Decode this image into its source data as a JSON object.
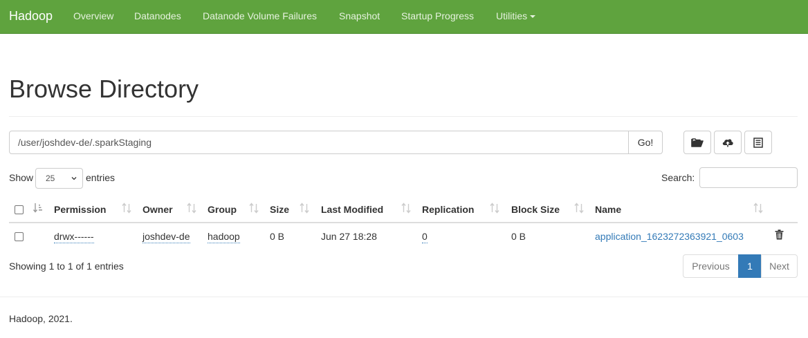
{
  "navbar": {
    "brand": "Hadoop",
    "items": [
      "Overview",
      "Datanodes",
      "Datanode Volume Failures",
      "Snapshot",
      "Startup Progress",
      "Utilities"
    ]
  },
  "page": {
    "title": "Browse Directory"
  },
  "path_bar": {
    "path": "/user/joshdev-de/.sparkStaging",
    "go_label": "Go!"
  },
  "toolbar_icons": [
    "folder-open-icon",
    "cloud-upload-icon",
    "list-icon"
  ],
  "table_controls": {
    "show_label": "Show",
    "page_length": "25",
    "entries_label": "entries",
    "search_label": "Search:",
    "search_value": ""
  },
  "table": {
    "columns": [
      "Permission",
      "Owner",
      "Group",
      "Size",
      "Last Modified",
      "Replication",
      "Block Size",
      "Name"
    ],
    "rows": [
      {
        "permission": "drwx------",
        "owner": "joshdev-de",
        "group": "hadoop",
        "size": "0 B",
        "last_modified": "Jun 27 18:28",
        "replication": "0",
        "block_size": "0 B",
        "name": "application_1623272363921_0603"
      }
    ]
  },
  "info": "Showing 1 to 1 of 1 entries",
  "pagination": {
    "previous": "Previous",
    "current": "1",
    "next": "Next"
  },
  "footer": "Hadoop, 2021.",
  "colors": {
    "navbar_bg": "#5fa33e",
    "link": "#337ab7",
    "active_page": "#337ab7"
  }
}
